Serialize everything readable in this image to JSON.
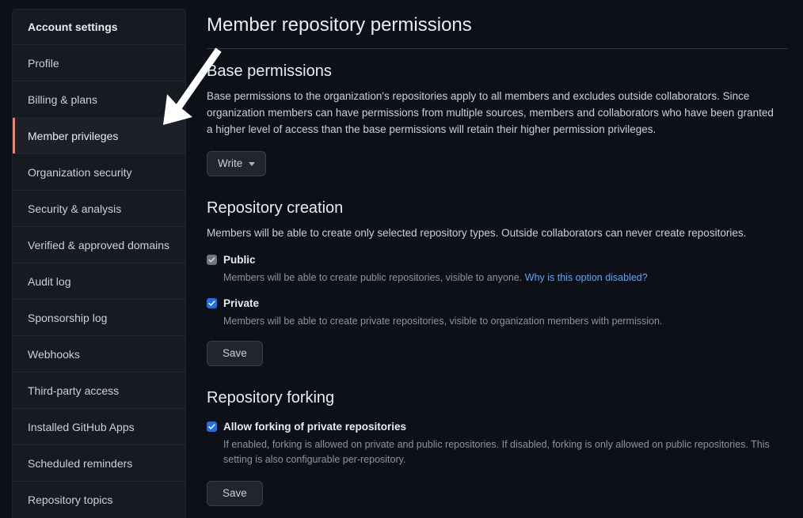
{
  "sidebar": {
    "heading": "Account settings",
    "items": [
      {
        "label": "Profile",
        "active": false
      },
      {
        "label": "Billing & plans",
        "active": false
      },
      {
        "label": "Member privileges",
        "active": true
      },
      {
        "label": "Organization security",
        "active": false
      },
      {
        "label": "Security & analysis",
        "active": false
      },
      {
        "label": "Verified & approved domains",
        "active": false
      },
      {
        "label": "Audit log",
        "active": false
      },
      {
        "label": "Sponsorship log",
        "active": false
      },
      {
        "label": "Webhooks",
        "active": false
      },
      {
        "label": "Third-party access",
        "active": false
      },
      {
        "label": "Installed GitHub Apps",
        "active": false
      },
      {
        "label": "Scheduled reminders",
        "active": false
      },
      {
        "label": "Repository topics",
        "active": false
      }
    ],
    "active_accent_color": "#f78166"
  },
  "main": {
    "page_title": "Member repository permissions",
    "base_permissions": {
      "title": "Base permissions",
      "description": "Base permissions to the organization's repositories apply to all members and excludes outside collaborators. Since organization members can have permissions from multiple sources, members and collaborators who have been granted a higher level of access than the base permissions will retain their higher permission privileges.",
      "dropdown_value": "Write"
    },
    "repository_creation": {
      "title": "Repository creation",
      "description": "Members will be able to create only selected repository types. Outside collaborators can never create repositories.",
      "options": [
        {
          "label": "Public",
          "note": "Members will be able to create public repositories, visible to anyone.",
          "link_text": "Why is this option disabled?",
          "checked": true,
          "disabled": true
        },
        {
          "label": "Private",
          "note": "Members will be able to create private repositories, visible to organization members with permission.",
          "link_text": "",
          "checked": true,
          "disabled": false
        }
      ],
      "save_label": "Save"
    },
    "repository_forking": {
      "title": "Repository forking",
      "option": {
        "label": "Allow forking of private repositories",
        "note": "If enabled, forking is allowed on private and public repositories. If disabled, forking is only allowed on public repositories. This setting is also configurable per-repository.",
        "checked": true
      },
      "save_label": "Save"
    }
  },
  "annotation": {
    "arrow_color": "#ffffff",
    "points_to": "Member privileges"
  },
  "colors": {
    "page_background": "#0d1117",
    "panel_background": "#161b22",
    "border": "#21262d",
    "link": "#58a6ff",
    "checked": "#1f6feb",
    "disabled_checkbox": "#6e7681"
  }
}
